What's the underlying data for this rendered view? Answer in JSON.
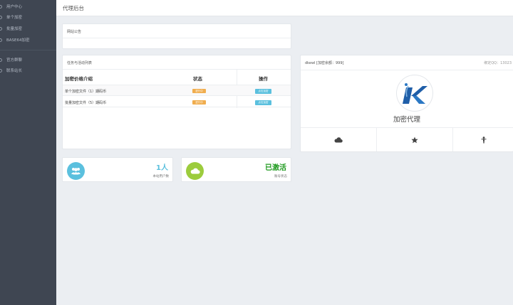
{
  "sidebar": {
    "items": [
      {
        "label": "用户中心",
        "icon": "circle-icon"
      },
      {
        "label": "单个加密",
        "icon": "circle-icon"
      },
      {
        "label": "批量加密",
        "icon": "circle-icon"
      },
      {
        "label": "BASE64加密",
        "icon": "circle-icon"
      },
      {
        "label": "官方群聊",
        "icon": "circle-icon"
      },
      {
        "label": "联系站长",
        "icon": "circle-icon"
      }
    ]
  },
  "header": {
    "title": "代理后台"
  },
  "announcement": {
    "title": "网站公告"
  },
  "tasks": {
    "title": "任务与活动列表",
    "columns": [
      "加密价格介绍",
      "状态",
      "操作"
    ],
    "rows": [
      {
        "name": "单个加密文件（1）期码币",
        "status": "进行中",
        "action": "点击加密"
      },
      {
        "name": "批量加密文件（5）期码币",
        "status": "进行中",
        "action": "点击加密"
      }
    ]
  },
  "stats": [
    {
      "value": "1人",
      "label": "本站用户数",
      "color": "#5bc0de",
      "icon": "users-icon"
    },
    {
      "value": "已激活",
      "label": "账号状态",
      "color": "#9ccc3d",
      "icon": "cloud-icon"
    }
  ],
  "profile": {
    "user": "dkewl [加密余额：999]",
    "qq": "绑定QQ：13023",
    "name": "加密代理",
    "footer_icons": [
      "cloud-icon",
      "star-icon",
      "person-icon"
    ]
  },
  "colors": {
    "sidebar": "#3f4652",
    "badge_warning": "#f0ad4e",
    "button_info": "#5bc0de",
    "active_green": "#1e9a1e",
    "count_blue": "#5bc0de"
  }
}
